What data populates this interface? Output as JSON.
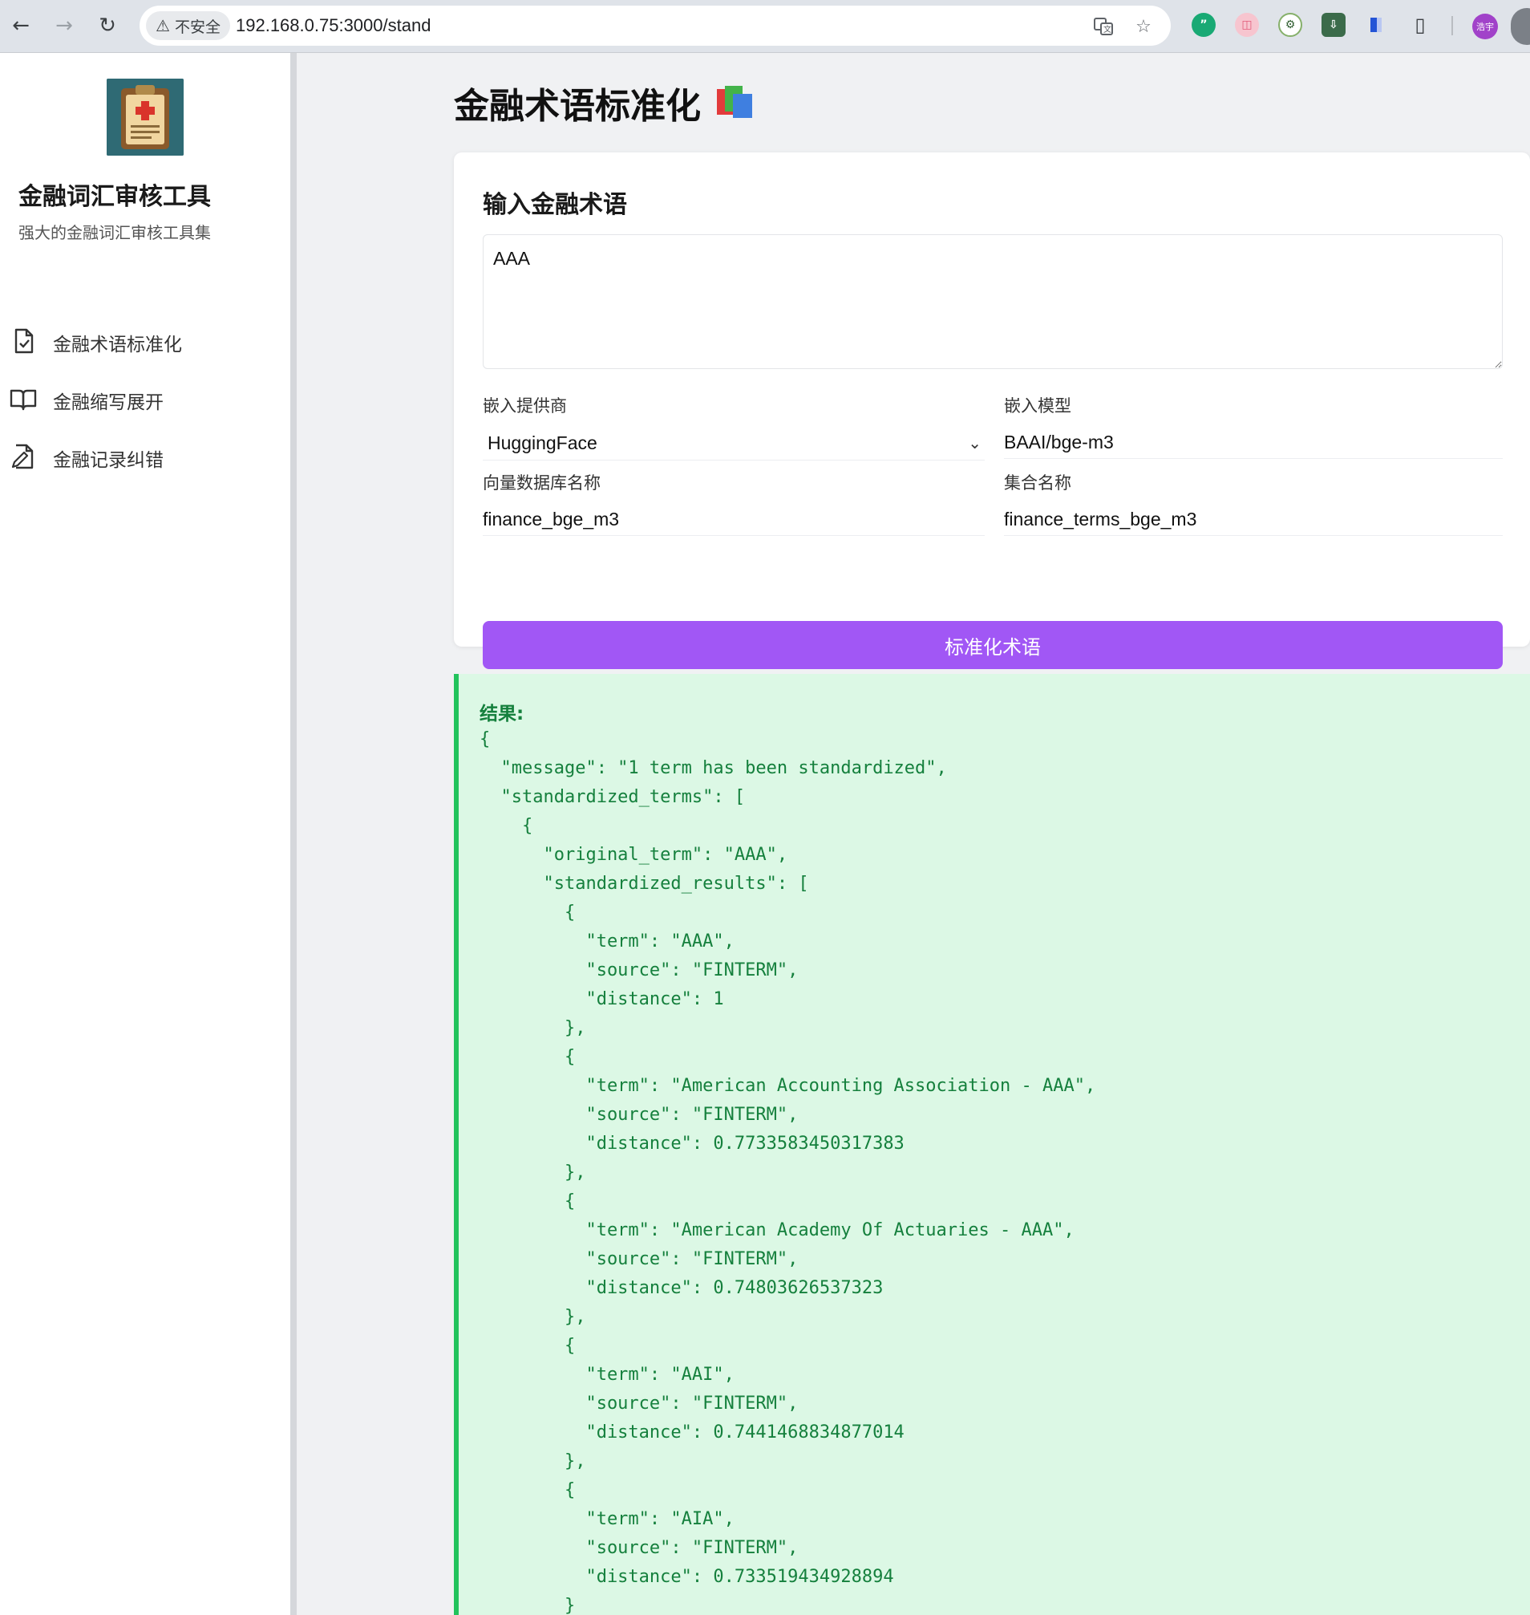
{
  "browser": {
    "security_label": "不安全",
    "url": "192.168.0.75:3000/stand",
    "profile_initials": "浩宇"
  },
  "sidebar": {
    "app_title": "金融词汇审核工具",
    "app_subtitle": "强大的金融词汇审核工具集",
    "items": [
      {
        "label": "金融术语标准化",
        "icon": "file-check-icon"
      },
      {
        "label": "金融缩写展开",
        "icon": "open-book-icon"
      },
      {
        "label": "金融记录纠错",
        "icon": "file-edit-icon"
      }
    ]
  },
  "main": {
    "page_title": "金融术语标准化",
    "card_title": "输入金融术语",
    "term_input_value": "AAA",
    "provider_label": "嵌入提供商",
    "provider_value": "HuggingFace",
    "model_label": "嵌入模型",
    "model_value": "BAAI/bge-m3",
    "db_label": "向量数据库名称",
    "db_value": "finance_bge_m3",
    "collection_label": "集合名称",
    "collection_value": "finance_terms_bge_m3",
    "submit_label": "标准化术语",
    "result_label": "结果:",
    "result_json": "{\n  \"message\": \"1 term has been standardized\",\n  \"standardized_terms\": [\n    {\n      \"original_term\": \"AAA\",\n      \"standardized_results\": [\n        {\n          \"term\": \"AAA\",\n          \"source\": \"FINTERM\",\n          \"distance\": 1\n        },\n        {\n          \"term\": \"American Accounting Association - AAA\",\n          \"source\": \"FINTERM\",\n          \"distance\": 0.7733583450317383\n        },\n        {\n          \"term\": \"American Academy Of Actuaries - AAA\",\n          \"source\": \"FINTERM\",\n          \"distance\": 0.74803626537323\n        },\n        {\n          \"term\": \"AAI\",\n          \"source\": \"FINTERM\",\n          \"distance\": 0.7441468834877014\n        },\n        {\n          \"term\": \"AIA\",\n          \"source\": \"FINTERM\",\n          \"distance\": 0.733519434928894\n        }"
  },
  "colors": {
    "accent": "#a157f5",
    "result_bg": "#dcf8e5",
    "result_border": "#22c35c",
    "result_text": "#15803d"
  }
}
